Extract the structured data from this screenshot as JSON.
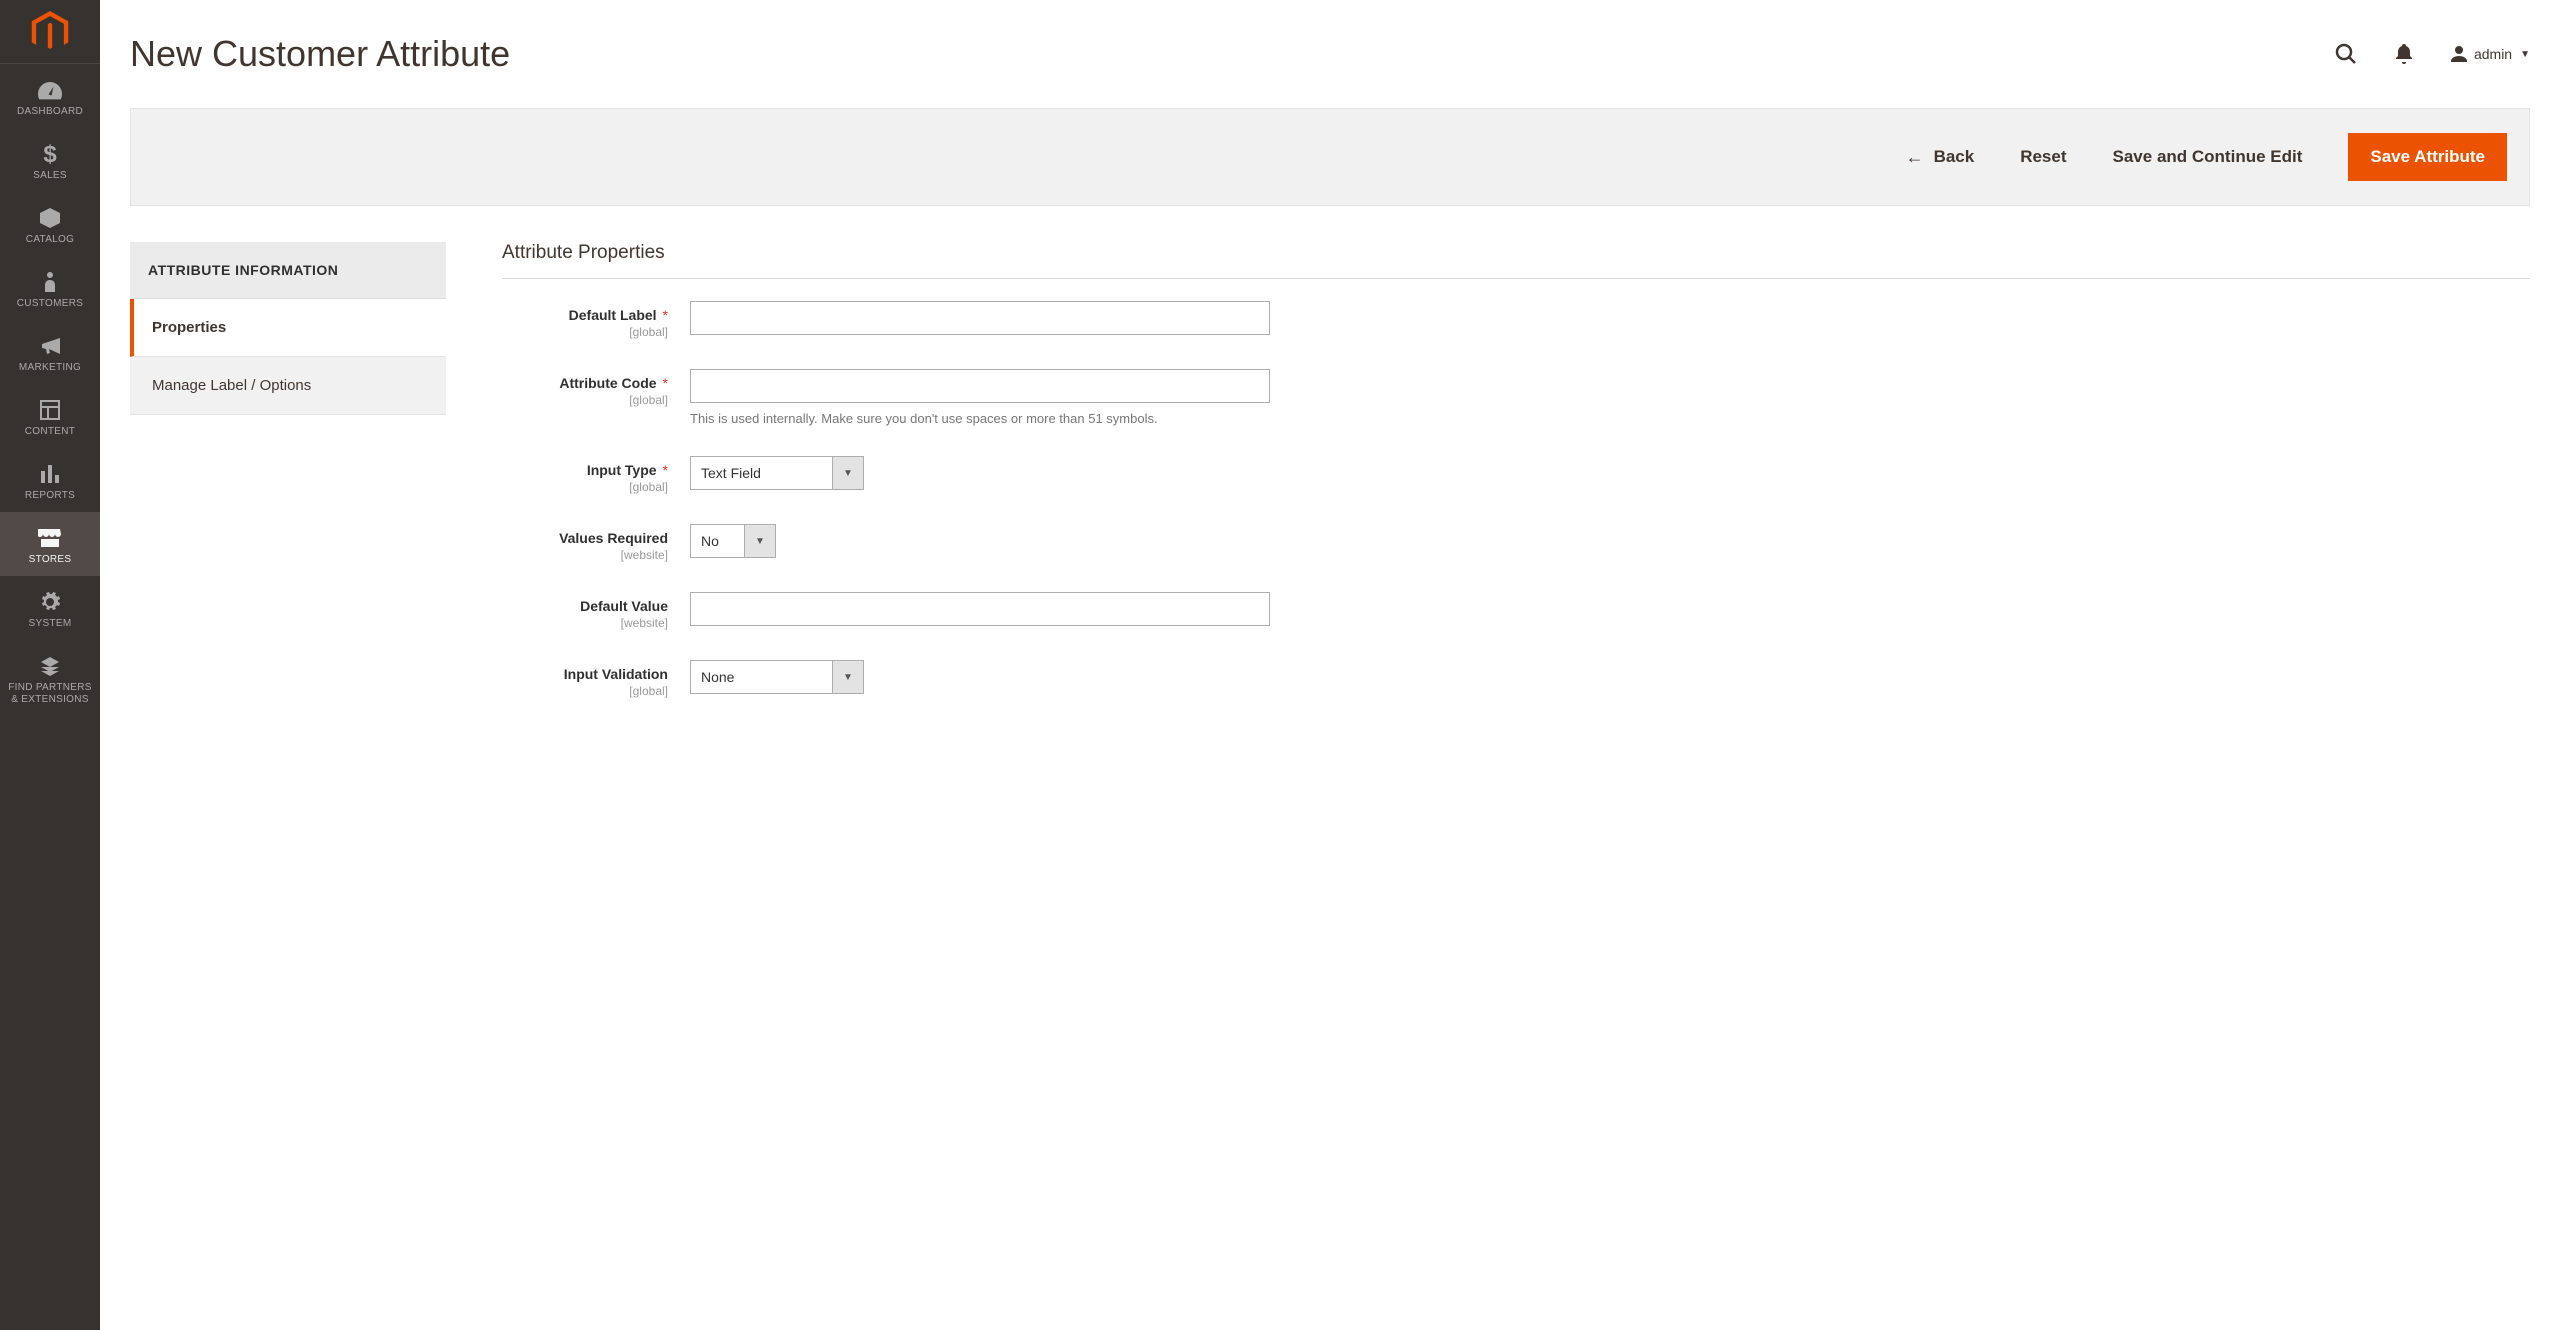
{
  "header": {
    "title": "New Customer Attribute",
    "user_label": "admin"
  },
  "sidebar_nav": {
    "dashboard": "DASHBOARD",
    "sales": "SALES",
    "catalog": "CATALOG",
    "customers": "CUSTOMERS",
    "marketing": "MARKETING",
    "content": "CONTENT",
    "reports": "REPORTS",
    "stores": "STORES",
    "system": "SYSTEM",
    "partners_l1": "FIND PARTNERS",
    "partners_l2": "& EXTENSIONS"
  },
  "actions": {
    "back": "Back",
    "reset": "Reset",
    "save_continue": "Save and Continue Edit",
    "save": "Save Attribute"
  },
  "tabs": {
    "header": "ATTRIBUTE INFORMATION",
    "properties": "Properties",
    "manage": "Manage Label / Options"
  },
  "form": {
    "section_title": "Attribute Properties",
    "scope_global": "[global]",
    "scope_website": "[website]",
    "default_label": {
      "label": "Default Label",
      "value": ""
    },
    "attribute_code": {
      "label": "Attribute Code",
      "value": "",
      "help": "This is used internally. Make sure you don't use spaces or more than 51 symbols."
    },
    "input_type": {
      "label": "Input Type",
      "value": "Text Field"
    },
    "values_required": {
      "label": "Values Required",
      "value": "No"
    },
    "default_value": {
      "label": "Default Value",
      "value": ""
    },
    "input_validation": {
      "label": "Input Validation",
      "value": "None"
    }
  }
}
